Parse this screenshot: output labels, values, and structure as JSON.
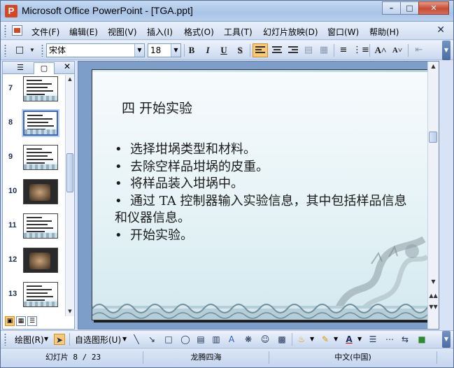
{
  "window": {
    "title": "Microsoft Office PowerPoint - [TGA.ppt]",
    "app_icon": "powerpoint-app-icon",
    "minimize_label": "–",
    "maximize_label": "□",
    "close_label": "✕"
  },
  "menu": {
    "items": [
      "文件(F)",
      "编辑(E)",
      "视图(V)",
      "插入(I)",
      "格式(O)",
      "工具(T)",
      "幻灯片放映(D)",
      "窗口(W)",
      "帮助(H)"
    ],
    "close_label": "✕"
  },
  "toolbar": {
    "font_name": "宋体",
    "font_size": "18",
    "bold": "B",
    "italic": "I",
    "underline": "U",
    "shadow": "S",
    "grow_font": "A˄",
    "shrink_font": "A˅"
  },
  "left_pane": {
    "tabs": [
      "☰",
      "▢"
    ],
    "close_label": "✕",
    "thumbnails": [
      {
        "number": "7",
        "kind": "text"
      },
      {
        "number": "8",
        "kind": "text",
        "selected": true
      },
      {
        "number": "9",
        "kind": "text"
      },
      {
        "number": "10",
        "kind": "photo"
      },
      {
        "number": "11",
        "kind": "text"
      },
      {
        "number": "12",
        "kind": "photo"
      },
      {
        "number": "13",
        "kind": "text"
      }
    ]
  },
  "slide": {
    "title": "四  开始实验",
    "bullets": [
      "•  选择坩埚类型和材料。",
      "•  去除空样品坩埚的皮重。",
      "•  将样品装入坩埚中。",
      "•  通过 TA 控制器输入实验信息，其中包括样品信息和仪器信息。",
      "•  开始实验。"
    ]
  },
  "drawbar": {
    "draw_label": "绘图(R)",
    "autoshapes_label": "自选图形(U)"
  },
  "status": {
    "slide_info": "幻灯片 8 / 23",
    "design": "龙腾四海",
    "language": "中文(中国)"
  }
}
